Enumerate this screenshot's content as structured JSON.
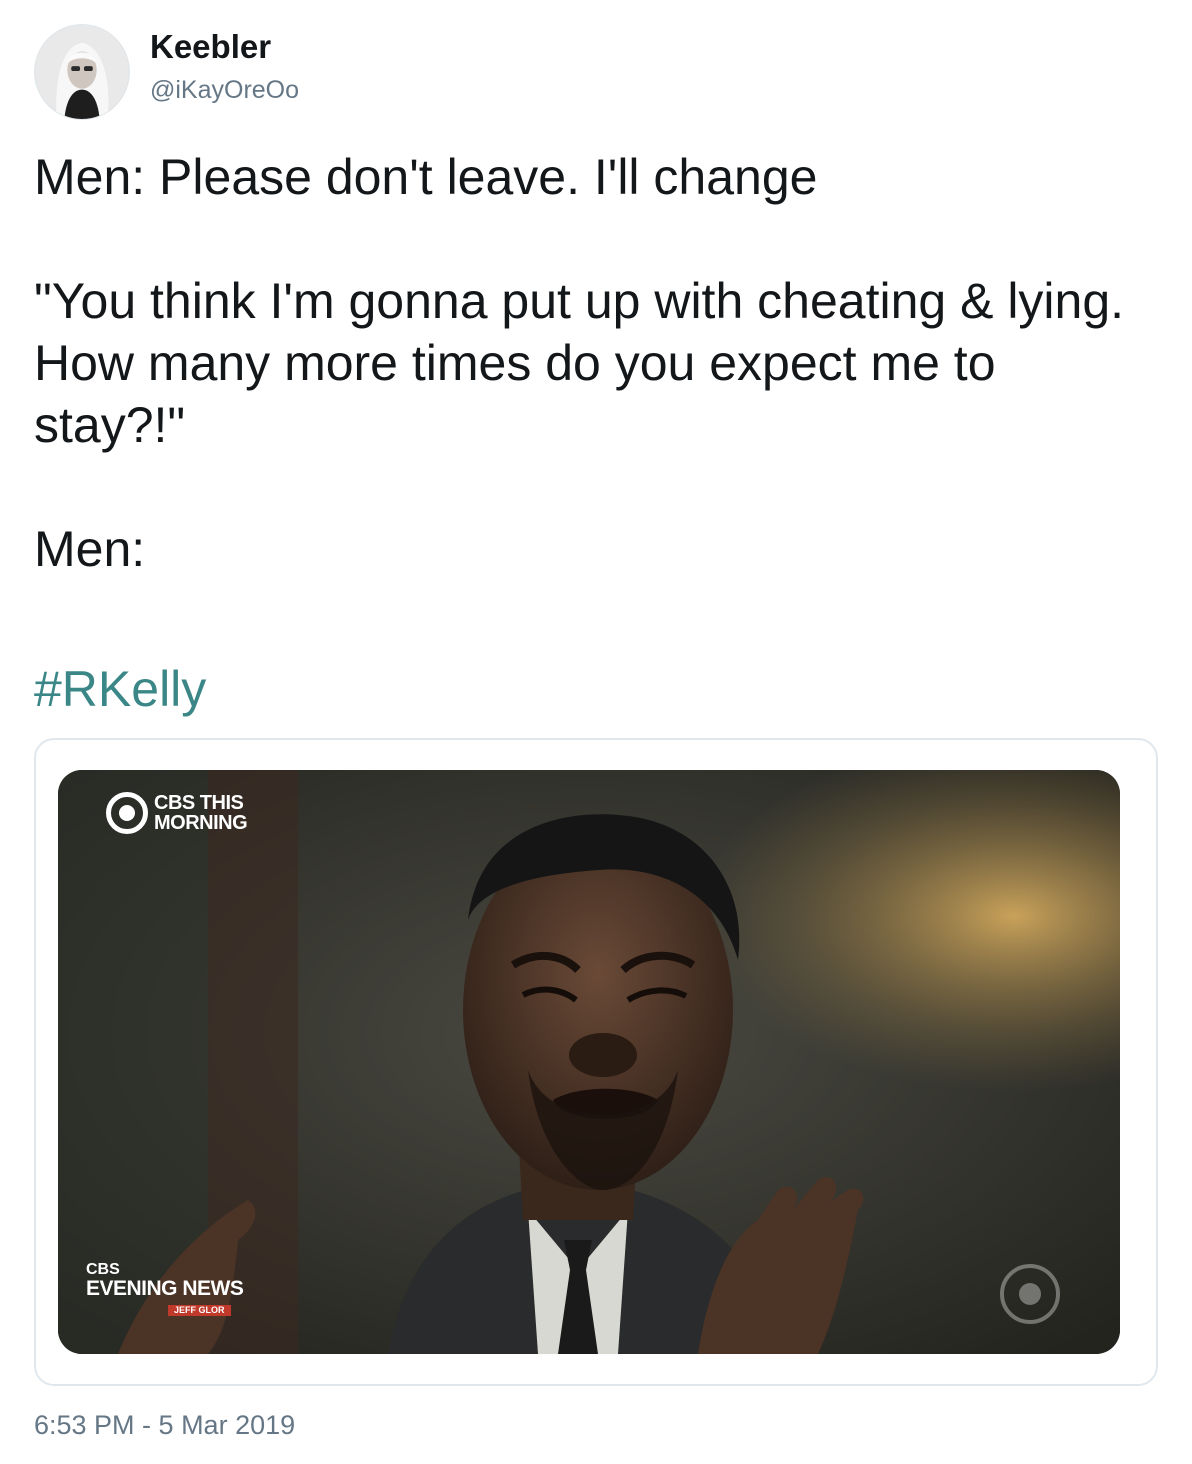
{
  "author": {
    "display_name": "Keebler",
    "handle": "@iKayOreOo",
    "avatar_icon": "profile-avatar"
  },
  "tweet": {
    "text": "Men: Please don't leave. I'll change\n\n\"You think I'm gonna put up with cheating & lying. How many more times do you expect me to stay?!\"\n\nMen:",
    "hashtag": "#RKelly",
    "hashtag_color": "#3b8686"
  },
  "media": {
    "network_bug_line1": "CBS THIS",
    "network_bug_line2": "MORNING",
    "lower_bug_line1": "CBS",
    "lower_bug_line2": "EVENING NEWS",
    "lower_bug_tag": "JEFF GLOR"
  },
  "meta": {
    "timestamp": "6:53 PM - 5 Mar 2019"
  },
  "colors": {
    "text": "#14171a",
    "secondary": "#657786",
    "border": "#e1e8ed"
  }
}
